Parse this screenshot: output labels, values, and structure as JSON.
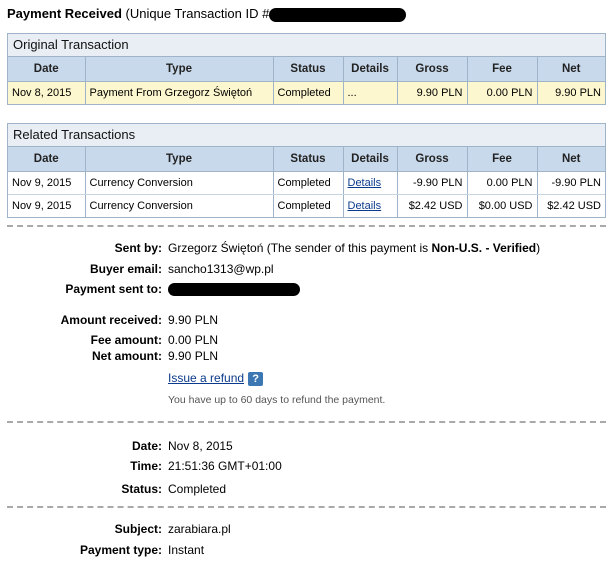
{
  "header": {
    "title_bold": "Payment Received",
    "title_rest": " (Unique Transaction ID #"
  },
  "columns": [
    "Date",
    "Type",
    "Status",
    "Details",
    "Gross",
    "Fee",
    "Net"
  ],
  "original": {
    "heading": "Original Transaction",
    "rows": [
      {
        "date": "Nov 8, 2015",
        "type": "Payment From Grzegorz Świętoń",
        "status": "Completed",
        "details": "...",
        "gross": "9.90 PLN",
        "fee": "0.00 PLN",
        "net": "9.90 PLN"
      }
    ]
  },
  "related": {
    "heading": "Related Transactions",
    "rows": [
      {
        "date": "Nov 9, 2015",
        "type": "Currency Conversion",
        "status": "Completed",
        "details": "Details",
        "gross": "-9.90 PLN",
        "fee": "0.00 PLN",
        "net": "-9.90 PLN"
      },
      {
        "date": "Nov 9, 2015",
        "type": "Currency Conversion",
        "status": "Completed",
        "details": "Details",
        "gross": "$2.42 USD",
        "fee": "$0.00 USD",
        "net": "$2.42 USD"
      }
    ]
  },
  "info": {
    "sent_by_label": "Sent by:",
    "sent_by_name": "Grzegorz Świętoń",
    "sent_by_mid": " (The sender of this payment is ",
    "sent_by_status": "Non-U.S. - Verified",
    "sent_by_end": ")",
    "buyer_email_label": "Buyer email:",
    "buyer_email": "sancho1313@wp.pl",
    "payment_sent_to_label": "Payment sent to:",
    "amount_received_label": "Amount received:",
    "amount_received": "9.90 PLN",
    "fee_amount_label": "Fee amount:",
    "fee_amount": "0.00 PLN",
    "net_amount_label": "Net amount:",
    "net_amount": "9.90 PLN",
    "refund_link": "Issue a refund",
    "help_icon": "?",
    "refund_note": "You have up to 60 days to refund the payment.",
    "date_label": "Date:",
    "date": "Nov 8, 2015",
    "time_label": "Time:",
    "time": "21:51:36 GMT+01:00",
    "status_label": "Status:",
    "status": "Completed",
    "subject_label": "Subject:",
    "subject": "zarabiara.pl",
    "payment_type_label": "Payment type:",
    "payment_type": "Instant"
  },
  "colors": {
    "header_bg": "#c9d9ec",
    "highlight_row": "#fdf7cf",
    "link": "#0b3a8c",
    "help_icon_bg": "#3d77b3"
  }
}
